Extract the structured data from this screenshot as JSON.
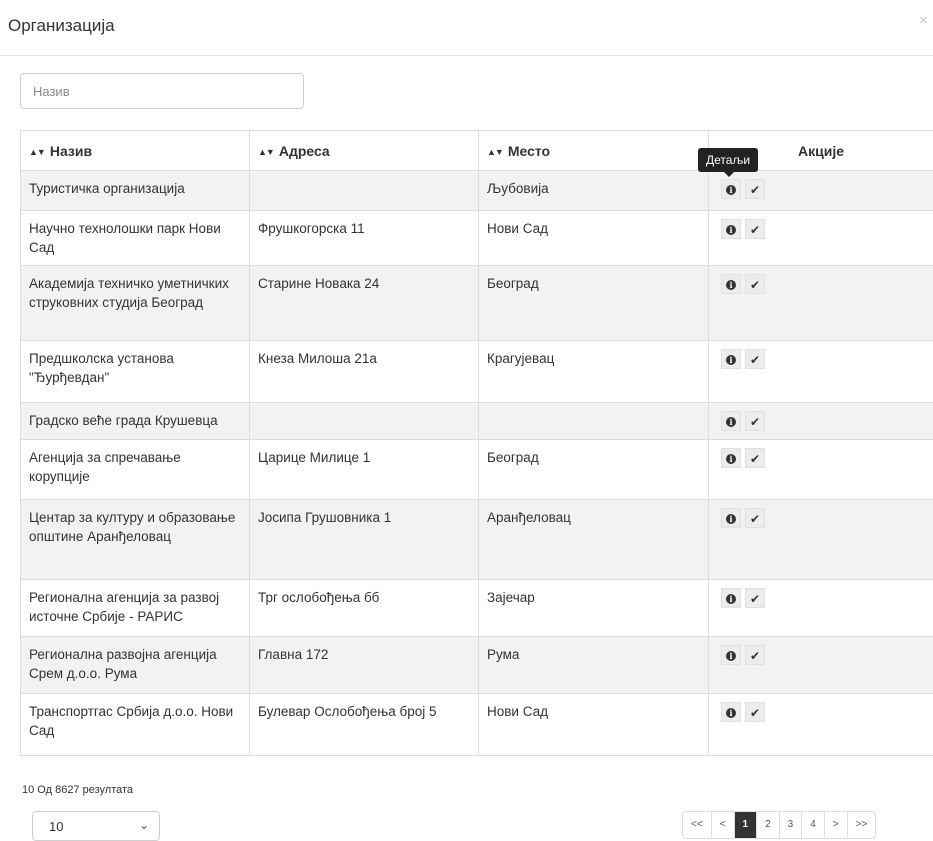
{
  "modal": {
    "title": "Организација",
    "close_label": "×"
  },
  "search": {
    "placeholder": "Назив"
  },
  "table": {
    "columns": [
      "Назив",
      "Адреса",
      "Место",
      "Акције"
    ],
    "rows": [
      {
        "name": "Туристичка организација",
        "address": "",
        "place": "Љубовија"
      },
      {
        "name": "Научно технолошки парк Нови Сад",
        "address": "Фрушкогорска 11",
        "place": "Нови Сад"
      },
      {
        "name": "Академија техничко уметничких струковних студија Београд",
        "address": "Старине Новака 24",
        "place": "Београд"
      },
      {
        "name": "Предшколска установа \"Ђурђевдан\"",
        "address": "Кнеза Милоша 21а",
        "place": "Крагујевац"
      },
      {
        "name": "Градско веће града Крушевца",
        "address": "",
        "place": ""
      },
      {
        "name": "Агенција за спречавање корупције",
        "address": "Царице Милице 1",
        "place": "Београд"
      },
      {
        "name": "Центар за културу и образовање општине Аранђеловац",
        "address": "Јосипа Грушовника 1",
        "place": "Аранђеловац"
      },
      {
        "name": "Регионална агенција за развој источне Србије - РАРИС",
        "address": "Трг ослобођења бб",
        "place": "Зајечар"
      },
      {
        "name": "Регионална развојна агенција Срем д.о.о. Рума",
        "address": "Главна 172",
        "place": "Рума"
      },
      {
        "name": "Транспортгас Србија д.о.о. Нови Сад",
        "address": "Булевар Ослобођења број 5",
        "place": "Нови Сад"
      }
    ],
    "sort_icon": "▲▼",
    "action_icons": {
      "details": "info-icon",
      "select": "check-icon"
    },
    "info_glyph": "i",
    "check_glyph": "✔"
  },
  "tooltip": {
    "text": "Детаљи"
  },
  "results": {
    "text": "10 Од 8627 резултата"
  },
  "page_size": {
    "selected": "10",
    "chevron": "⌄"
  },
  "pagination": {
    "labels": [
      "<<",
      "<",
      "1",
      "2",
      "3",
      "4",
      ">",
      ">>"
    ],
    "active": "1"
  },
  "colors": {
    "row_stripe": "#f2f2f2",
    "active_page": "#333333",
    "tooltip_bg": "#222222"
  }
}
